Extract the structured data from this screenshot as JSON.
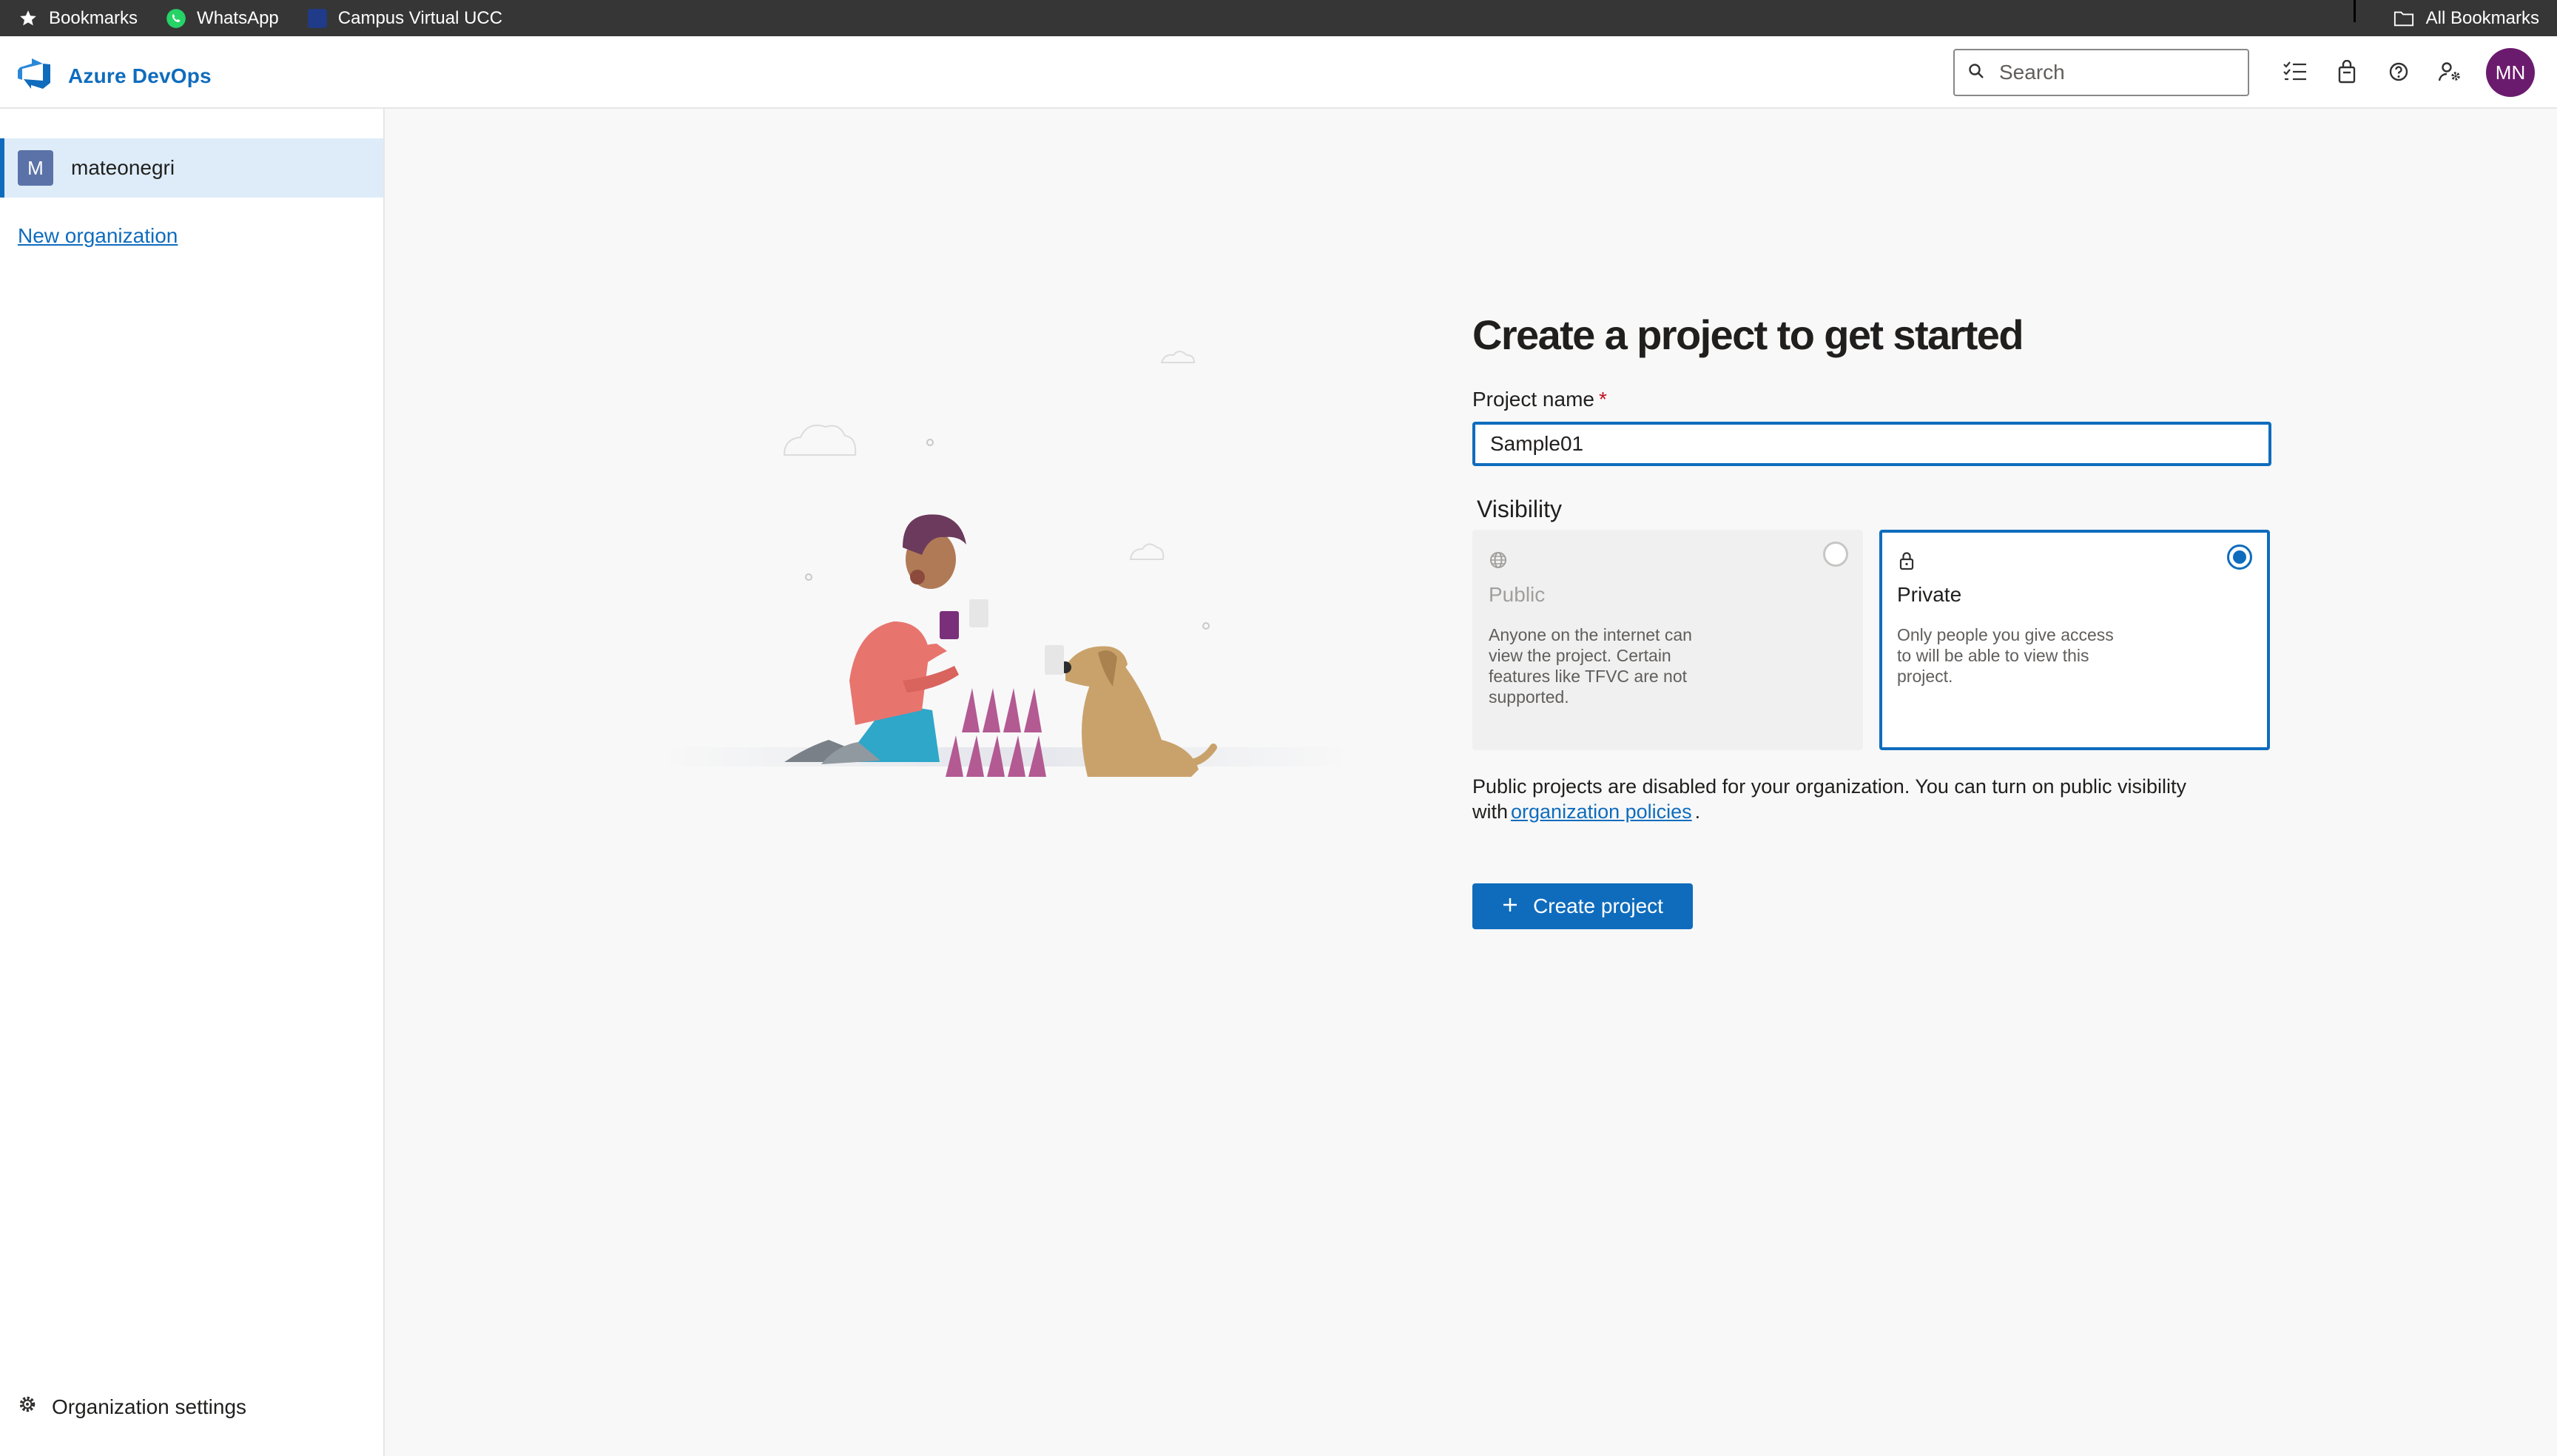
{
  "bookmarks_bar": {
    "items": [
      {
        "label": "Bookmarks",
        "icon": "star-icon"
      },
      {
        "label": "WhatsApp",
        "icon": "whatsapp-icon"
      },
      {
        "label": "Campus Virtual UCC",
        "icon": "campus-favicon-icon"
      }
    ],
    "all_bookmarks_label": "All Bookmarks"
  },
  "header": {
    "brand": "Azure DevOps",
    "search_placeholder": "Search",
    "icons": [
      "task-list-icon",
      "shopping-bag-icon",
      "help-icon",
      "user-settings-icon"
    ],
    "avatar_initials": "MN"
  },
  "sidebar": {
    "organization": {
      "initial": "M",
      "name": "mateonegri"
    },
    "new_org_label": "New organization",
    "settings_label": "Organization settings"
  },
  "form": {
    "title": "Create a project to get started",
    "project_name_label": "Project name",
    "required_marker": "*",
    "project_name_value": "Sample01",
    "visibility_label": "Visibility",
    "options": {
      "public": {
        "title": "Public",
        "description": "Anyone on the internet can view the project. Certain features like TFVC are not supported.",
        "selected": false
      },
      "private": {
        "title": "Private",
        "description": "Only people you give access to will be able to view this project.",
        "selected": true
      }
    },
    "notice_text": "Public projects are disabled for your organization. You can turn on public visibility with",
    "notice_link": "organization policies",
    "notice_end": ".",
    "create_button_label": "Create project"
  },
  "colors": {
    "accent": "#0f6cbd",
    "selected_row": "#deecf9",
    "avatar": "#6b1b6e",
    "bookmark_bar": "#363636"
  }
}
